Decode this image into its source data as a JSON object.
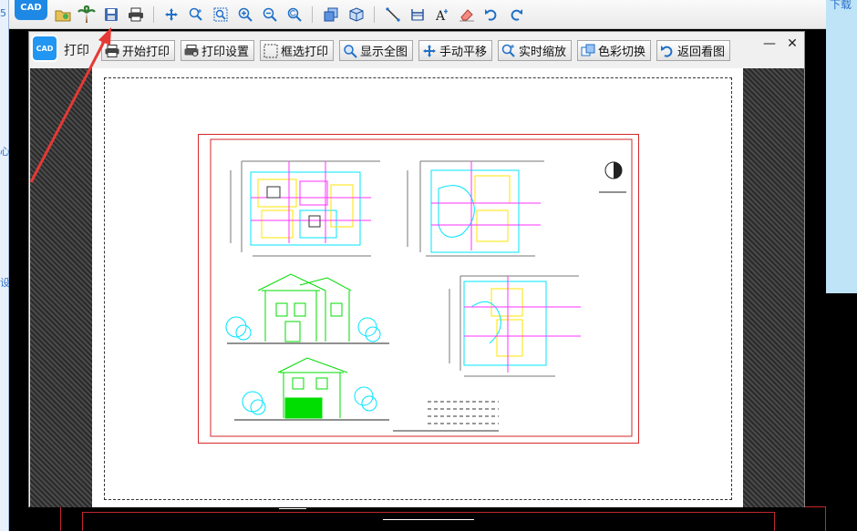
{
  "background": {
    "left_fragments": [
      "5",
      "心",
      "设"
    ],
    "right_fragment": "下载"
  },
  "toolbar": {
    "app_logo_text": "CAD",
    "icons": [
      "open-file-icon",
      "palm-tree-icon",
      "save-icon",
      "print-icon",
      "pan-icon",
      "zoom-realtime-icon",
      "zoom-window-icon",
      "zoom-in-icon",
      "zoom-out-icon",
      "zoom-previous-icon",
      "3d-view-icon",
      "3d-box-icon",
      "line-icon",
      "dimension-icon",
      "text-icon",
      "eraser-icon",
      "undo-icon",
      "redo-icon"
    ]
  },
  "dialog": {
    "logo_text": "CAD",
    "title": "打印",
    "buttons": {
      "start_print": "开始打印",
      "print_settings": "打印设置",
      "window_print": "框选打印",
      "show_all": "显示全图",
      "manual_pan": "手动平移",
      "realtime_zoom": "实时缩放",
      "color_switch": "色彩切换",
      "back_to_view": "返回看图"
    },
    "minimize": "—",
    "close": "✕"
  },
  "colors": {
    "accent": "#1e88e5",
    "cad_cyan": "#00e5ff",
    "cad_yellow": "#ffe600",
    "cad_magenta": "#ff33ff",
    "cad_green": "#00dd00",
    "cad_red": "#d62728",
    "arrow_red": "#e53935"
  }
}
